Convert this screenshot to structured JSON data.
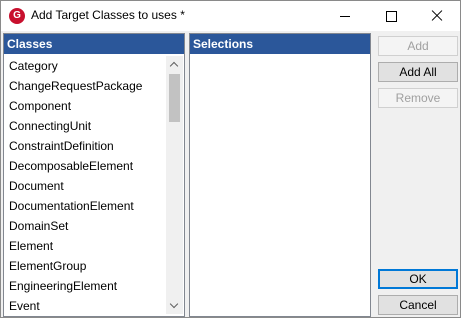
{
  "window": {
    "title": "Add Target Classes to uses *",
    "app_icon_letter": "G"
  },
  "classes": {
    "header": "Classes",
    "items": [
      "Category",
      "ChangeRequestPackage",
      "Component",
      "ConnectingUnit",
      "ConstraintDefinition",
      "DecomposableElement",
      "Document",
      "DocumentationElement",
      "DomainSet",
      "Element",
      "ElementGroup",
      "EngineeringElement",
      "Event"
    ]
  },
  "selections": {
    "header": "Selections",
    "items": []
  },
  "buttons": {
    "add": "Add",
    "add_all": "Add All",
    "remove": "Remove",
    "ok": "OK",
    "cancel": "Cancel"
  }
}
